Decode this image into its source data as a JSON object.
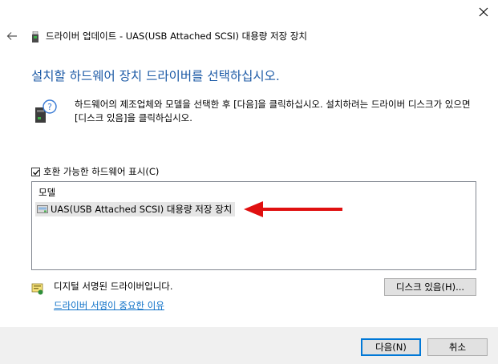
{
  "window": {
    "title": "드라이버 업데이트 - UAS(USB Attached SCSI) 대용량 저장 장치"
  },
  "heading": "설치할 하드웨어 장치 드라이버를 선택하십시오.",
  "description": "하드웨어의 제조업체와 모델을 선택한 후 [다음]을 클릭하십시오. 설치하려는 드라이버 디스크가 있으면 [디스크 있음]을 클릭하십시오.",
  "compat": {
    "label": "호환 가능한 하드웨어 표시(C)",
    "checked": true
  },
  "list": {
    "header": "모델",
    "items": [
      {
        "label": "UAS(USB Attached SCSI) 대용량 저장 장치",
        "selected": true
      }
    ]
  },
  "signed": {
    "text": "디지털 서명된 드라이버입니다.",
    "link": "드라이버 서명이 중요한 이유"
  },
  "buttons": {
    "have_disk": "디스크 있음(H)...",
    "next": "다음(N)",
    "cancel": "취소"
  },
  "icons": {
    "close": "close-icon",
    "back": "back-arrow-icon",
    "title": "usb-drive-icon",
    "info": "device-help-icon",
    "item": "storage-device-icon",
    "signed": "signed-driver-icon",
    "annotation": "red-arrow-icon"
  },
  "colors": {
    "heading": "#1c5aa6",
    "link": "#0b6fc7",
    "arrow": "#e01010",
    "bottom_bar": "#f0f0f0",
    "default_button_border": "#0078d7"
  }
}
